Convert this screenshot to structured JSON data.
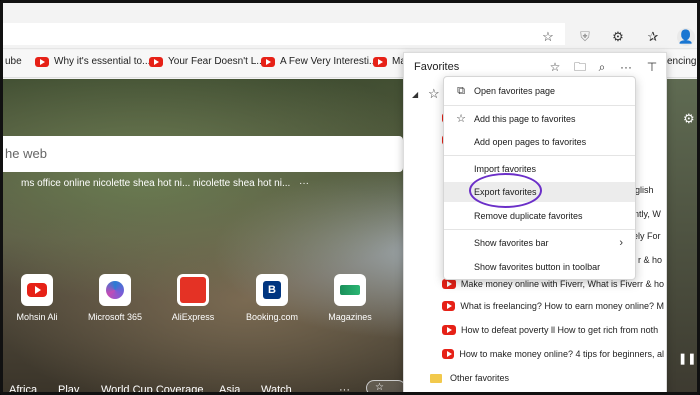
{
  "bookmarks": [
    {
      "label": "ube"
    },
    {
      "label": "Why it's essential to..."
    },
    {
      "label": "Your Fear Doesn't L..."
    },
    {
      "label": "A Few Very Interesti..."
    },
    {
      "label": "Ma"
    },
    {
      "label": "encing..."
    }
  ],
  "search": {
    "placeholder": "he web"
  },
  "trending": [
    "ms office online",
    "nicolette shea hot ni...",
    "nicolette shea hot ni...",
    "···"
  ],
  "tiles": [
    {
      "label": "Mohsin Ali",
      "icon": "youtube-icon"
    },
    {
      "label": "Microsoft 365",
      "icon": "microsoft365-icon"
    },
    {
      "label": "AliExpress",
      "icon": "aliexpress-icon"
    },
    {
      "label": "Booking.com",
      "icon": "booking-icon"
    },
    {
      "label": "Magazines",
      "icon": "magazines-icon"
    }
  ],
  "bottom_nav": [
    "Africa",
    "Play",
    "World Cup Coverage",
    "Asia",
    "Watch",
    "···"
  ],
  "favorites": {
    "title": "Favorites",
    "rows": [
      {
        "label": "nglish",
        "right": true
      },
      {
        "label": "ntly, W",
        "right": true
      },
      {
        "label": "ely For",
        "right": true
      },
      {
        "label": "r & ho",
        "right": true
      },
      {
        "label": "Make money online with Fiverr, What is Fiverr & ho"
      },
      {
        "label": "What is freelancing? How to earn money online? M"
      },
      {
        "label": "How to defeat poverty ll How to get rich from noth"
      },
      {
        "label": "How to make money online? 4 tips for beginners, al"
      }
    ],
    "other_folder": "Other favorites"
  },
  "menu": {
    "open_favorites": "Open favorites page",
    "add_this_page": "Add this page to favorites",
    "add_open_pages": "Add open pages to favorites",
    "import": "Import favorites",
    "export": "Export favorites",
    "remove_duplicates": "Remove duplicate favorites",
    "show_bar": "Show favorites bar",
    "show_button": "Show favorites button in toolbar"
  },
  "colors": {
    "accent_circle": "#6b2fc8",
    "youtube_red": "#e62117"
  }
}
